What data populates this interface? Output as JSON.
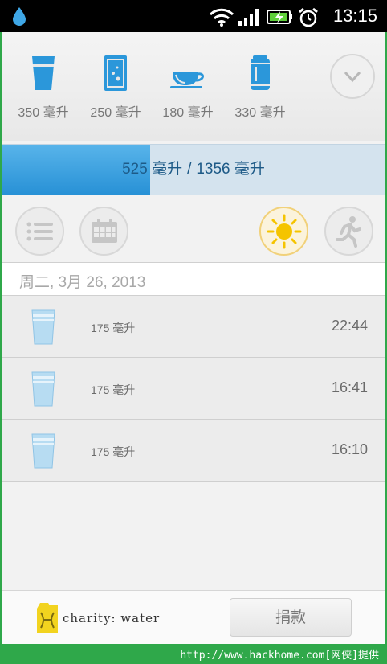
{
  "status_bar": {
    "time": "13:15",
    "icons": [
      "water-drop-icon",
      "wifi-icon",
      "signal-icon",
      "battery-charging-icon",
      "alarm-clock-icon"
    ]
  },
  "quick_add": [
    {
      "icon": "glass-icon",
      "label": "350 毫升"
    },
    {
      "icon": "tall-glass-icon",
      "label": "250 毫升"
    },
    {
      "icon": "teacup-icon",
      "label": "180 毫升"
    },
    {
      "icon": "can-icon",
      "label": "330 毫升"
    }
  ],
  "progress": {
    "consumed": "525 毫升",
    "separator": "/",
    "goal": "1356 毫升",
    "fraction": 0.387
  },
  "toolbar": {
    "left": [
      "list-icon",
      "calendar-icon"
    ],
    "right": [
      "sun-icon",
      "runner-icon"
    ]
  },
  "date_header": "周二, 3月 26, 2013",
  "entries": [
    {
      "amount": "175 毫升",
      "time": "22:44"
    },
    {
      "amount": "175 毫升",
      "time": "16:41"
    },
    {
      "amount": "175 毫升",
      "time": "16:10"
    }
  ],
  "footer": {
    "charity_name": "charity: water",
    "donate_label": "捐款"
  },
  "watermark": "http://www.hackhome.com[网侠]提供",
  "colors": {
    "accent_blue": "#2891d6",
    "progress_track": "#d4e3ee",
    "sun_yellow": "#f5c400",
    "charity_yellow": "#f2d31f"
  }
}
